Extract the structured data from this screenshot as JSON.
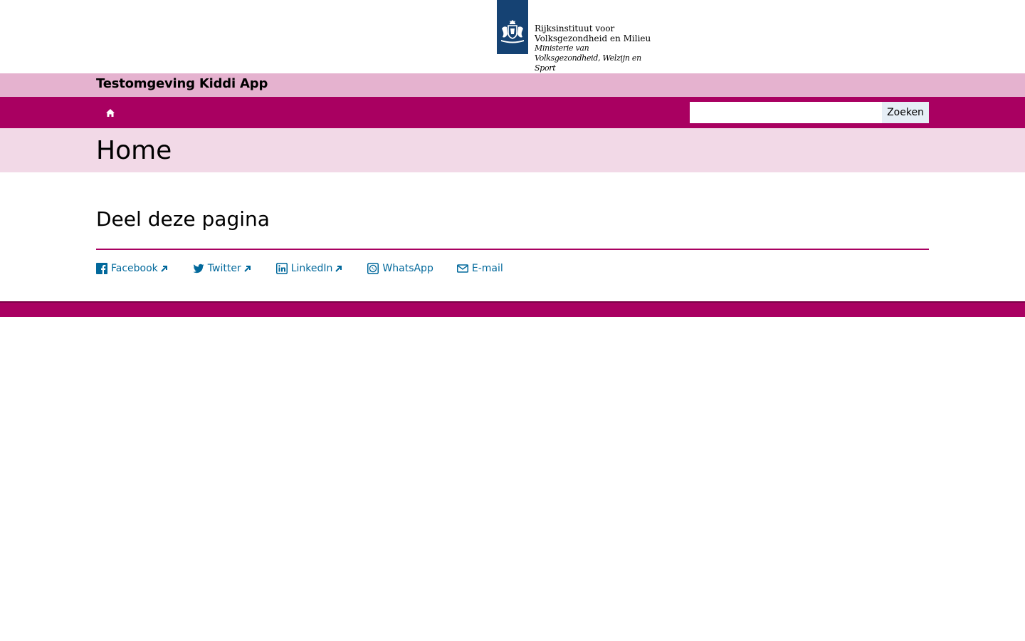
{
  "header": {
    "org_name": "Rijksinstituut voor Volksgezondheid en Milieu",
    "ministry_name": "Ministerie van Volksgezondheid, Welzijn en Sport",
    "logo_icon": "coat-of-arms-icon"
  },
  "site": {
    "title": "Testomgeving Kiddi App"
  },
  "nav": {
    "home_icon": "home-icon",
    "search_placeholder": "",
    "search_value": "",
    "search_button_label": "Zoeken"
  },
  "page": {
    "title": "Home"
  },
  "share": {
    "title": "Deel deze pagina",
    "items": [
      {
        "label": "Facebook",
        "icon": "facebook-icon",
        "external": true
      },
      {
        "label": "Twitter",
        "icon": "twitter-icon",
        "external": true
      },
      {
        "label": "LinkedIn",
        "icon": "linkedin-icon",
        "external": true
      },
      {
        "label": "WhatsApp",
        "icon": "whatsapp-icon",
        "external": false
      },
      {
        "label": "E-mail",
        "icon": "email-icon",
        "external": false
      }
    ]
  },
  "colors": {
    "brand": "#a90061",
    "brand_light": "#e5b2cf",
    "brand_lighter": "#f2d9e7",
    "logo_blue": "#154273",
    "link": "#01689b"
  }
}
